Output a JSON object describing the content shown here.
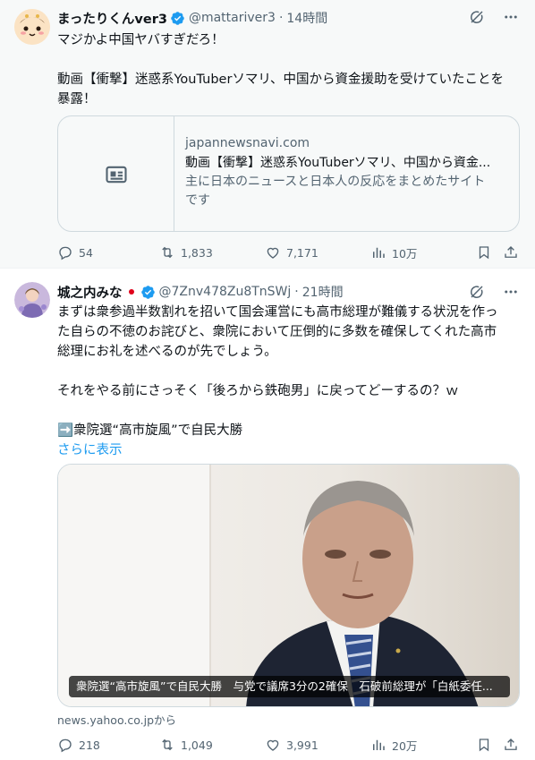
{
  "colors": {
    "accent": "#1d9bf0",
    "secondary_text": "#536471",
    "verified": "#1d9bf0"
  },
  "tweet1": {
    "display_name": "まったりくんver3",
    "handle": "@mattariver3",
    "separator": "·",
    "time": "14時間",
    "text_lines": [
      "マジかよ中国ヤバすぎだろ！",
      "",
      "動画【衝撃】迷惑系YouTuberソマリ、中国から資金援助を受けていたことを",
      "暴露！"
    ],
    "card": {
      "domain": "japannewsnavi.com",
      "title": "動画【衝撃】迷惑系YouTuberソマリ、中国から資金...",
      "description_lines": [
        "主に日本のニュースと日本人の反応をまとめたサイト",
        "です"
      ]
    },
    "replies": "54",
    "retweets": "1,833",
    "likes": "7,171",
    "views": "10万",
    "icons": [
      "grok-icon",
      "more-icon",
      "reply-icon",
      "retweet-icon",
      "like-icon",
      "views-icon",
      "bookmark-icon",
      "share-icon"
    ]
  },
  "tweet2": {
    "display_name": "城之内みな",
    "flag": "🇯🇵",
    "handle": "@7Znv478Zu8TnSWj",
    "separator": "·",
    "time": "21時間",
    "text_lines": [
      "まずは衆参過半数割れを招いて国会運営にも高市総理が難儀する状況を作っ",
      "た自らの不徳のお詫びと、衆院において圧倒的に多数を確保してくれた高市",
      "総理にお礼を述べるのが先でしょう。",
      "",
      "それをやる前にさっそく「後ろから鉄砲男」に戻ってどーするの？ｗ",
      "",
      "➡️衆院選“高市旋風”で自民大勝"
    ],
    "show_more": "さらに表示",
    "media_caption": "衆院選“高市旋風”で自民大勝　与党で議席3分の2確保　石破前総理が「白紙委任...",
    "source": "news.yahoo.co.jpから",
    "replies": "218",
    "retweets": "1,049",
    "likes": "3,991",
    "views": "20万"
  }
}
